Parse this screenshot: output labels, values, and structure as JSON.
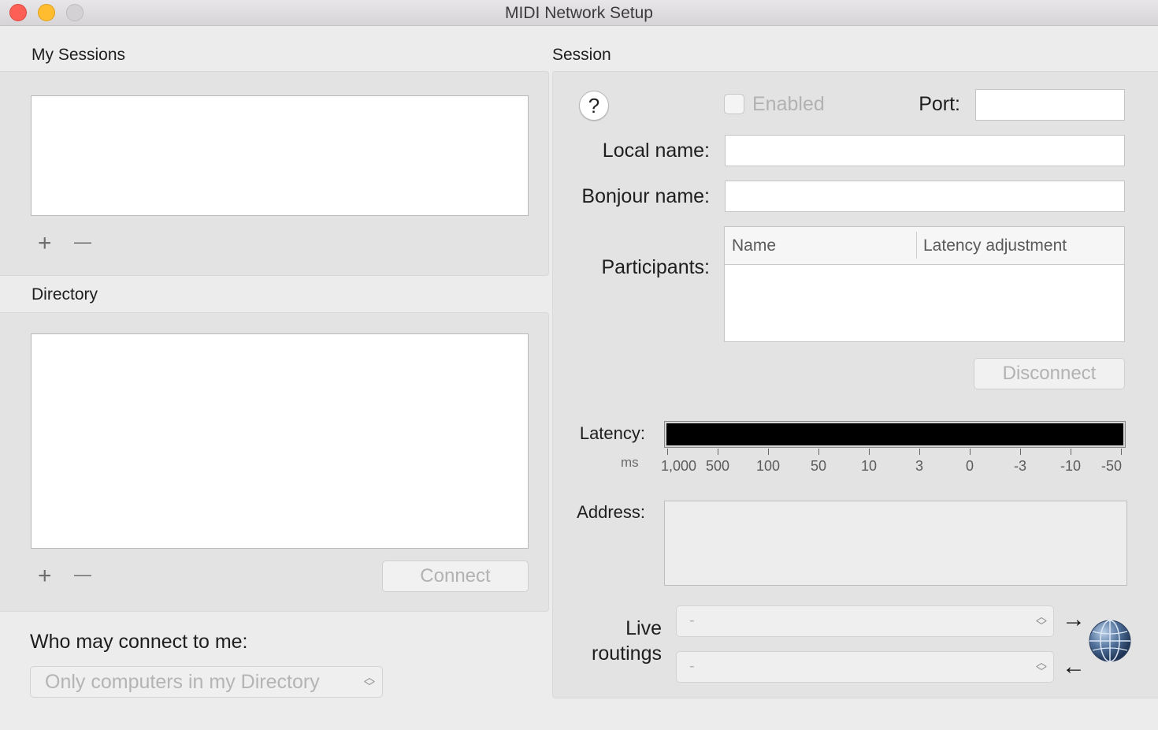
{
  "window": {
    "title": "MIDI Network Setup"
  },
  "my_sessions": {
    "label": "My Sessions",
    "add": "+",
    "remove": "—"
  },
  "directory": {
    "label": "Directory",
    "add": "+",
    "remove": "—",
    "connect_label": "Connect"
  },
  "access": {
    "label": "Who may connect to me:",
    "selected": "Only computers in my Directory"
  },
  "session": {
    "label": "Session",
    "help": "?",
    "enabled_label": "Enabled",
    "port_label": "Port:",
    "port_value": "",
    "local_name_label": "Local name:",
    "local_name_value": "",
    "bonjour_name_label": "Bonjour name:",
    "bonjour_name_value": "",
    "participants_label": "Participants:",
    "participants_columns": [
      "Name",
      "Latency adjustment"
    ],
    "disconnect_label": "Disconnect",
    "latency_label": "Latency:",
    "latency_unit": "ms",
    "latency_scale": [
      "1,000",
      "500",
      "100",
      "50",
      "10",
      "3",
      "0",
      "-3",
      "-10",
      "-50"
    ],
    "address_label": "Address:",
    "live_routings_label_1": "Live",
    "live_routings_label_2": "routings",
    "routing_in_value": "-",
    "routing_out_value": "-",
    "routing_in_arrow": "→",
    "routing_out_arrow": "←"
  },
  "icons": {
    "network": "network-globe-icon",
    "popup": "popup-chevron-icon"
  }
}
